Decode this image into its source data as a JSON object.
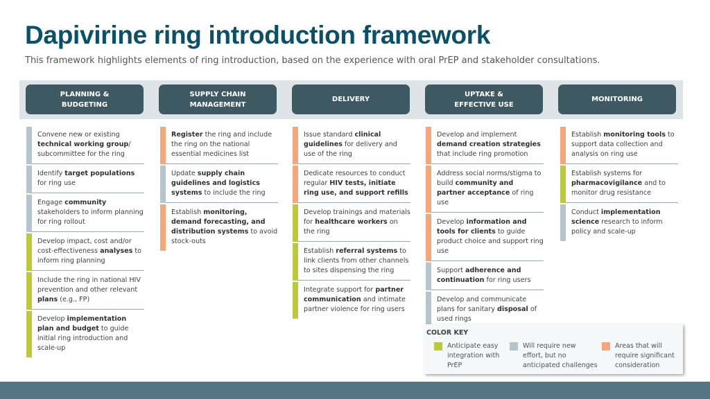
{
  "title": "Dapivirine ring introduction framework",
  "subtitle": "This framework highlights elements of ring introduction, based on the experience with oral PrEP and stakeholder consultations.",
  "colors": {
    "green": "#bcc93b",
    "blue": "#b4c5cb",
    "orange": "#f4a77a",
    "header": "#3f5963",
    "title": "#0b5069"
  },
  "columns": [
    {
      "header": "PLANNING &\nBUDGETING",
      "items": [
        {
          "color": "blue",
          "html": "Convene new or existing <b>technical working group</b>/ subcommittee for the ring"
        },
        {
          "color": "blue",
          "html": "Identify <b>target populations</b> for ring use"
        },
        {
          "color": "blue",
          "html": "Engage <b>community</b> stakeholders to inform planning for ring rollout"
        },
        {
          "color": "green",
          "html": "Develop impact, cost and/or cost-effectiveness <b>analyses</b> to inform ring planning"
        },
        {
          "color": "green",
          "html": "Include the ring in national HIV prevention and other relevant <b>plans</b> (e.g., FP)"
        },
        {
          "color": "green",
          "html": "Develop <b>implementation plan and budget</b> to guide initial ring introduction and scale-up"
        }
      ]
    },
    {
      "header": "SUPPLY CHAIN\nMANAGEMENT",
      "items": [
        {
          "color": "orange",
          "html": "<b>Register</b> the ring and include the ring on the national essential medicines list"
        },
        {
          "color": "blue",
          "html": "Update <b>supply chain guidelines and logistics systems</b> to include the ring"
        },
        {
          "color": "orange",
          "html": "Establish <b>monitoring, demand forecasting, and distribution systems</b> to avoid stock-outs"
        }
      ]
    },
    {
      "header": "DELIVERY",
      "items": [
        {
          "color": "orange",
          "html": "Issue standard <b>clinical guidelines</b> for delivery and use of the ring"
        },
        {
          "color": "orange",
          "html": "Dedicate resources to conduct regular <b>HIV tests, initiate ring use, and support refills</b>"
        },
        {
          "color": "green",
          "html": "Develop trainings and materials for <b>healthcare workers</b> on the ring"
        },
        {
          "color": "green",
          "html": "Establish <b>referral systems</b> to link clients from other channels to sites dispensing the ring"
        },
        {
          "color": "green",
          "html": "Integrate support for <b>partner communication</b> and intimate partner violence for ring users"
        }
      ]
    },
    {
      "header": "UPTAKE &\nEFFECTIVE USE",
      "items": [
        {
          "color": "orange",
          "html": "Develop and implement <b>demand creation strategies</b> that include ring promotion"
        },
        {
          "color": "orange",
          "html": "Address social norms/stigma to build <b>community and partner acceptance</b> of ring use"
        },
        {
          "color": "orange",
          "html": "Develop <b>information and tools for clients</b> to guide product choice and support ring use"
        },
        {
          "color": "blue",
          "html": "Support <b>adherence and continuation</b> for ring users"
        },
        {
          "color": "blue",
          "html": "Develop and communicate plans for sanitary <b>disposal</b> of used rings"
        }
      ]
    },
    {
      "header": "MONITORING",
      "items": [
        {
          "color": "orange",
          "html": "Establish <b>monitoring tools</b> to support data collection and analysis on ring use"
        },
        {
          "color": "green",
          "html": "Establish systems for <b>pharmacovigilance</b> and to monitor drug resistance"
        },
        {
          "color": "blue",
          "html": "Conduct <b>implementation science</b> research to inform policy and scale-up"
        }
      ]
    }
  ],
  "color_key": {
    "title": "COLOR KEY",
    "entries": [
      {
        "color": "green",
        "label": "Anticipate easy\nintegration with\nPrEP"
      },
      {
        "color": "blue",
        "label": "Will require new\neffort, but no\nanticipated challenges"
      },
      {
        "color": "orange",
        "label": "Areas that will\nrequire significant\nconsideration"
      }
    ]
  }
}
